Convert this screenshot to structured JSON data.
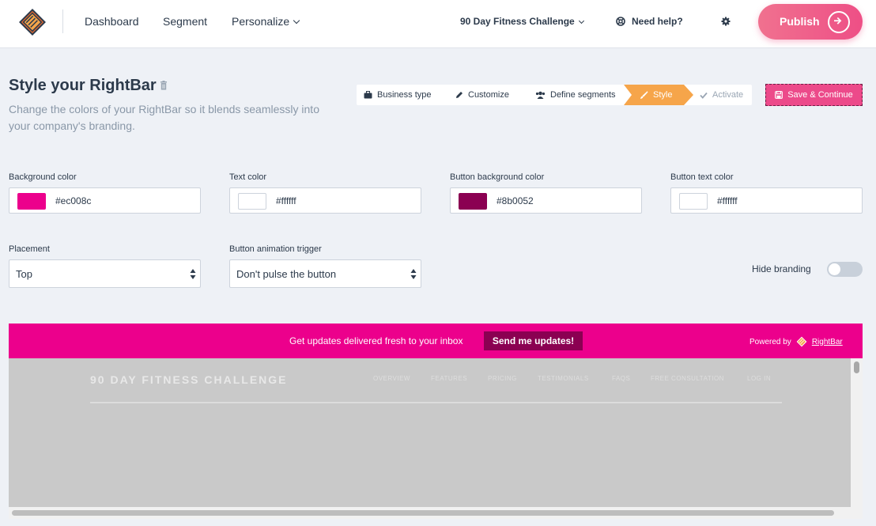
{
  "topnav": {
    "items": [
      {
        "label": "Dashboard"
      },
      {
        "label": "Segment"
      },
      {
        "label": "Personalize"
      }
    ],
    "project": "90 Day Fitness Challenge",
    "help": "Need help?",
    "publish": "Publish"
  },
  "header": {
    "title": "Style your RightBar",
    "subtitle": "Change the colors of your RightBar so it blends seamlessly into your company's branding."
  },
  "steps": [
    {
      "label": "Business type",
      "icon": "briefcase-icon",
      "state": "done"
    },
    {
      "label": "Customize",
      "icon": "pencil-icon",
      "state": "done"
    },
    {
      "label": "Define segments",
      "icon": "users-icon",
      "state": "done"
    },
    {
      "label": "Style",
      "icon": "brush-icon",
      "state": "active"
    },
    {
      "label": "Activate",
      "icon": "check-icon",
      "state": "disabled"
    }
  ],
  "save_continue": "Save & Continue",
  "colors": {
    "background": {
      "label": "Background color",
      "value": "#ec008c"
    },
    "text": {
      "label": "Text color",
      "value": "#ffffff"
    },
    "button_bg": {
      "label": "Button background color",
      "value": "#8b0052"
    },
    "button_text": {
      "label": "Button text color",
      "value": "#ffffff"
    }
  },
  "placement": {
    "label": "Placement",
    "value": "Top"
  },
  "animation": {
    "label": "Button animation trigger",
    "value": "Don't pulse the button"
  },
  "hide_branding": {
    "label": "Hide branding",
    "enabled": false
  },
  "preview": {
    "message": "Get updates delivered fresh to your inbox",
    "button": "Send me updates!",
    "powered_by": "Powered by",
    "brand": "RightBar",
    "site": {
      "title": "90 DAY FITNESS CHALLENGE",
      "nav": [
        "OVERVIEW",
        "FEATURES",
        "PRICING",
        "TESTIMONIALS",
        "FAQS",
        "FREE CONSULTATION",
        "LOG IN"
      ]
    }
  }
}
